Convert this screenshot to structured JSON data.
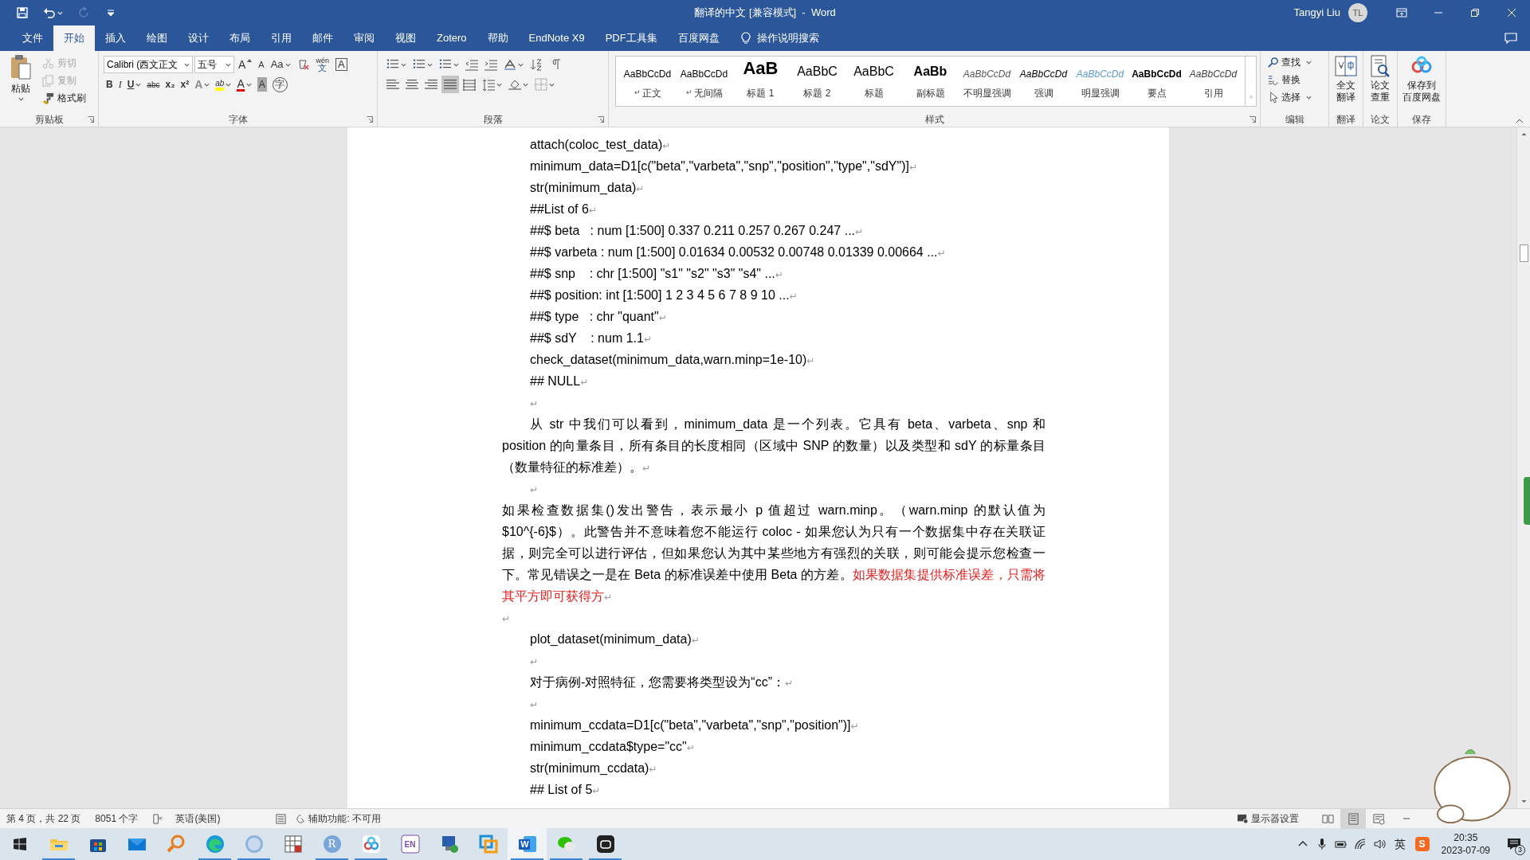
{
  "title_bar": {
    "quick_access": [
      {
        "kind": "save",
        "disabled": false
      },
      {
        "kind": "undo",
        "disabled": false
      },
      {
        "kind": "redo",
        "disabled": true
      },
      {
        "kind": "customize",
        "disabled": false
      }
    ],
    "title": "翻译的中文 [兼容模式]  -  Word",
    "user": "Tangyi Liu",
    "avatar": "TL"
  },
  "menu_tabs": [
    {
      "label": "文件",
      "selected": false
    },
    {
      "label": "开始",
      "selected": true
    },
    {
      "label": "插入",
      "selected": false
    },
    {
      "label": "绘图",
      "selected": false
    },
    {
      "label": "设计",
      "selected": false
    },
    {
      "label": "布局",
      "selected": false
    },
    {
      "label": "引用",
      "selected": false
    },
    {
      "label": "邮件",
      "selected": false
    },
    {
      "label": "审阅",
      "selected": false
    },
    {
      "label": "视图",
      "selected": false
    },
    {
      "label": "Zotero",
      "selected": false
    },
    {
      "label": "帮助",
      "selected": false
    },
    {
      "label": "EndNote X9",
      "selected": false
    },
    {
      "label": "PDF工具集",
      "selected": false
    },
    {
      "label": "百度网盘",
      "selected": false
    }
  ],
  "tell_me": "操作说明搜索",
  "ribbon": {
    "clipboard": {
      "paste": "粘贴",
      "tools": [
        {
          "kind": "cut",
          "label": "剪切",
          "disabled": true
        },
        {
          "kind": "copy",
          "label": "复制",
          "disabled": true
        },
        {
          "kind": "painter",
          "label": "格式刷",
          "disabled": false
        }
      ],
      "group": "剪贴板"
    },
    "font": {
      "font_name": "Calibri (西文正文",
      "font_size": "五号",
      "row1": [
        {
          "kind": "grow",
          "glyph": "A"
        },
        {
          "kind": "shrink",
          "glyph": "A"
        },
        {
          "kind": "case",
          "glyph": "Aa"
        },
        {
          "kind": "clear"
        },
        {
          "kind": "phonetic",
          "glyph": "wén",
          "sub": "文"
        },
        {
          "kind": "border",
          "glyph": "A"
        }
      ],
      "row2": [
        {
          "kind": "bold",
          "glyph": "B"
        },
        {
          "kind": "italic",
          "glyph": "I"
        },
        {
          "kind": "underline",
          "glyph": "U"
        },
        {
          "kind": "strike",
          "glyph": "abc"
        },
        {
          "kind": "sub",
          "glyph": "x₂"
        },
        {
          "kind": "sup",
          "glyph": "x²"
        },
        {
          "kind": "effects",
          "glyph": "A"
        },
        {
          "kind": "highlight",
          "glyph": "ab"
        },
        {
          "kind": "color",
          "glyph": "A"
        },
        {
          "kind": "shade",
          "glyph": "A"
        },
        {
          "kind": "enclose",
          "glyph": "字"
        }
      ],
      "group": "字体"
    },
    "paragraph": {
      "group": "段落"
    },
    "styles": {
      "items": [
        {
          "preview": "AaBbCcDd",
          "label": "正文",
          "kind": "normal",
          "mark": "↵"
        },
        {
          "preview": "AaBbCcDd",
          "label": "无间隔",
          "kind": "normal",
          "mark": "↵"
        },
        {
          "preview": "AaB",
          "label": "标题 1",
          "kind": "heading1"
        },
        {
          "preview": "AaBbC",
          "label": "标题 2",
          "kind": "heading2"
        },
        {
          "preview": "AaBbC",
          "label": "标题",
          "kind": "title"
        },
        {
          "preview": "AaBb",
          "label": "副标题",
          "kind": "subtitle"
        },
        {
          "preview": "AaBbCcDd",
          "label": "不明显强调",
          "kind": "subtle"
        },
        {
          "preview": "AaBbCcDd",
          "label": "强调",
          "kind": "emphasis"
        },
        {
          "preview": "AaBbCcDd",
          "label": "明显强调",
          "kind": "intense"
        },
        {
          "preview": "AaBbCcDd",
          "label": "要点",
          "kind": "strong"
        },
        {
          "preview": "AaBbCcDd",
          "label": "引用",
          "kind": "quote"
        }
      ],
      "group": "样式"
    },
    "editing": {
      "items": [
        {
          "kind": "find",
          "label": "查找",
          "dropdown": true
        },
        {
          "kind": "replace",
          "label": "替换",
          "dropdown": false
        },
        {
          "kind": "select",
          "label": "选择",
          "dropdown": true
        }
      ],
      "group": "编辑"
    },
    "addins": [
      {
        "kind": "translate",
        "label_lines": [
          "全文",
          "翻译"
        ],
        "group": "翻译"
      },
      {
        "kind": "check",
        "label_lines": [
          "论文",
          "查重"
        ],
        "group": "论文"
      },
      {
        "kind": "cloud",
        "label_lines": [
          "保存到",
          "百度网盘"
        ],
        "group": "保存"
      }
    ]
  },
  "document": {
    "paragraphs": [
      {
        "kind": "code",
        "text": "attach(coloc_test_data)",
        "mark": "↵"
      },
      {
        "kind": "code",
        "text": "minimum_data=D1[c(\"beta\",\"varbeta\",\"snp\",\"position\",\"type\",\"sdY\")]",
        "mark": "↵"
      },
      {
        "kind": "code",
        "text": "str(minimum_data)",
        "mark": "↵"
      },
      {
        "kind": "code",
        "text": "##List of 6",
        "mark": "↵"
      },
      {
        "kind": "code",
        "text": "##$ beta   : num [1:500] 0.337 0.211 0.257 0.267 0.247 ...",
        "mark": "↵"
      },
      {
        "kind": "code",
        "text": "##$ varbeta : num [1:500] 0.01634 0.00532 0.00748 0.01339 0.00664 ...",
        "mark": "↵"
      },
      {
        "kind": "code",
        "text": "##$ snp    : chr [1:500] \"s1\" \"s2\" \"s3\" \"s4\" ...",
        "mark": "↵"
      },
      {
        "kind": "code",
        "text": "##$ position: int [1:500] 1 2 3 4 5 6 7 8 9 10 ...",
        "mark": "↵"
      },
      {
        "kind": "code",
        "text": "##$ type   : chr \"quant\"",
        "mark": "↵"
      },
      {
        "kind": "code",
        "text": "##$ sdY    : num 1.1",
        "mark": "↵"
      },
      {
        "kind": "code",
        "text": "check_dataset(minimum_data,warn.minp=1e-10)",
        "mark": "↵"
      },
      {
        "kind": "code",
        "text": "## NULL",
        "mark": "↵"
      },
      {
        "kind": "code",
        "mark": "↵"
      },
      {
        "kind": "body",
        "segments": [
          {
            "text": "从 str 中我们可以看到，minimum_data 是一个列表。它具有 beta、varbeta、snp 和 position 的向量条目，所有条目的长度相同（区域中 SNP 的数量）以及类型和 sdY 的标量条目（数量特征的标准差）。",
            "red": false
          }
        ],
        "mark": "↵"
      },
      {
        "kind": "code",
        "mark": "↵"
      },
      {
        "kind": "plain",
        "segments": [
          {
            "text": "如果检查数据集()发出警告，表示最小 p 值超过 warn.minp。（warn.minp 的默认值为 $10^{-6}$）。此警告并不意味着您不能运行 coloc - 如果您认为只有一个数据集中存在关联证据，则完全可以进行评估，但如果您认为其中某些地方有强烈的关联，则可能会提示您检查一下。常见错误之一是在 Beta 的标准误差中使用 Beta 的方差。",
            "red": false
          },
          {
            "text": "如果数据集提供标准误差，只需将其平方即可获得方",
            "red": true
          }
        ],
        "mark": "↵"
      },
      {
        "kind": "plain",
        "mark": "↵"
      },
      {
        "kind": "code",
        "text": "plot_dataset(minimum_data)",
        "mark": "↵"
      },
      {
        "kind": "code",
        "mark": "↵"
      },
      {
        "kind": "code",
        "text": "对于病例-对照特征，您需要将类型设为“cc”：",
        "mark": "↵"
      },
      {
        "kind": "code",
        "mark": "↵"
      },
      {
        "kind": "code",
        "text": "minimum_ccdata=D1[c(\"beta\",\"varbeta\",\"snp\",\"position\")]",
        "mark": "↵"
      },
      {
        "kind": "code",
        "text": "minimum_ccdata$type=\"cc\"",
        "mark": "↵"
      },
      {
        "kind": "code",
        "text": "str(minimum_ccdata)",
        "mark": "↵"
      },
      {
        "kind": "code",
        "text": "## List of 5",
        "mark": "↵"
      }
    ]
  },
  "status_bar": {
    "page": "第 4 页，共 22 页",
    "words": "8051 个字",
    "language": "英语(美国)",
    "accessibility": "辅助功能: 不可用",
    "display_settings": "显示器设置",
    "views": [
      {
        "kind": "read",
        "selected": false
      },
      {
        "kind": "print",
        "selected": true
      },
      {
        "kind": "web",
        "selected": false
      }
    ]
  },
  "taskbar": {
    "apps": [
      {
        "kind": "explorer",
        "running": true,
        "active": false
      },
      {
        "kind": "store",
        "running": false,
        "active": false
      },
      {
        "kind": "mail",
        "running": false,
        "active": false
      },
      {
        "kind": "search",
        "running": false,
        "active": false
      },
      {
        "kind": "edge",
        "running": true,
        "active": false
      },
      {
        "kind": "math",
        "running": true,
        "active": false
      },
      {
        "kind": "grid",
        "running": false,
        "active": false
      },
      {
        "kind": "letter",
        "glyph": "R",
        "running": true,
        "active": false
      },
      {
        "kind": "cloud",
        "running": true,
        "active": false
      },
      {
        "kind": "letter2",
        "glyph": "EN",
        "running": false,
        "active": false
      },
      {
        "kind": "remote",
        "running": false,
        "active": false
      },
      {
        "kind": "boxes",
        "running": false,
        "active": false
      },
      {
        "kind": "word",
        "glyph": "W",
        "running": true,
        "active": true
      },
      {
        "kind": "chat",
        "running": true,
        "active": false
      },
      {
        "kind": "bot",
        "running": true,
        "active": false
      }
    ],
    "tray": [
      {
        "kind": "chevron"
      },
      {
        "kind": "mic"
      },
      {
        "kind": "battery"
      },
      {
        "kind": "wifi"
      },
      {
        "kind": "volume"
      },
      {
        "kind": "ime",
        "glyph": "英"
      },
      {
        "kind": "sogou",
        "glyph": "S"
      }
    ],
    "time": "20:35",
    "date": "2023-07-09",
    "notifications": "3"
  }
}
